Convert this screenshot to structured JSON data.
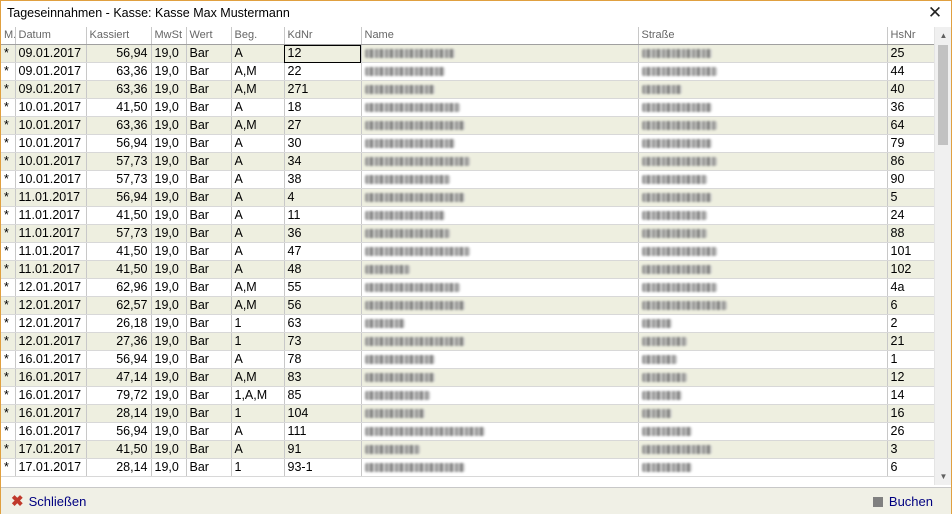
{
  "window": {
    "title": "Tageseinnahmen - Kasse: Kasse Max Mustermann",
    "close_glyph": "✕"
  },
  "columns": [
    "M.",
    "Datum",
    "Kassiert",
    "MwSt",
    "Wert",
    "Beg.",
    "KdNr",
    "Name",
    "Straße",
    "HsNr"
  ],
  "rows": [
    {
      "m": "*",
      "datum": "09.01.2017",
      "kassiert": "56,94",
      "mwst": "19,0",
      "wert": "Bar",
      "beg": "A",
      "kdnr": "12",
      "hsnr": "25"
    },
    {
      "m": "*",
      "datum": "09.01.2017",
      "kassiert": "63,36",
      "mwst": "19,0",
      "wert": "Bar",
      "beg": "A,M",
      "kdnr": "22",
      "hsnr": "44"
    },
    {
      "m": "*",
      "datum": "09.01.2017",
      "kassiert": "63,36",
      "mwst": "19,0",
      "wert": "Bar",
      "beg": "A,M",
      "kdnr": "271",
      "hsnr": "40"
    },
    {
      "m": "*",
      "datum": "10.01.2017",
      "kassiert": "41,50",
      "mwst": "19,0",
      "wert": "Bar",
      "beg": "A",
      "kdnr": "18",
      "hsnr": "36"
    },
    {
      "m": "*",
      "datum": "10.01.2017",
      "kassiert": "63,36",
      "mwst": "19,0",
      "wert": "Bar",
      "beg": "A,M",
      "kdnr": "27",
      "hsnr": "64"
    },
    {
      "m": "*",
      "datum": "10.01.2017",
      "kassiert": "56,94",
      "mwst": "19,0",
      "wert": "Bar",
      "beg": "A",
      "kdnr": "30",
      "hsnr": "79"
    },
    {
      "m": "*",
      "datum": "10.01.2017",
      "kassiert": "57,73",
      "mwst": "19,0",
      "wert": "Bar",
      "beg": "A",
      "kdnr": "34",
      "hsnr": "86"
    },
    {
      "m": "*",
      "datum": "10.01.2017",
      "kassiert": "57,73",
      "mwst": "19,0",
      "wert": "Bar",
      "beg": "A",
      "kdnr": "38",
      "hsnr": "90"
    },
    {
      "m": "*",
      "datum": "11.01.2017",
      "kassiert": "56,94",
      "mwst": "19,0",
      "wert": "Bar",
      "beg": "A",
      "kdnr": "4",
      "hsnr": "5"
    },
    {
      "m": "*",
      "datum": "11.01.2017",
      "kassiert": "41,50",
      "mwst": "19,0",
      "wert": "Bar",
      "beg": "A",
      "kdnr": "11",
      "hsnr": "24"
    },
    {
      "m": "*",
      "datum": "11.01.2017",
      "kassiert": "57,73",
      "mwst": "19,0",
      "wert": "Bar",
      "beg": "A",
      "kdnr": "36",
      "hsnr": "88"
    },
    {
      "m": "*",
      "datum": "11.01.2017",
      "kassiert": "41,50",
      "mwst": "19,0",
      "wert": "Bar",
      "beg": "A",
      "kdnr": "47",
      "hsnr": "101"
    },
    {
      "m": "*",
      "datum": "11.01.2017",
      "kassiert": "41,50",
      "mwst": "19,0",
      "wert": "Bar",
      "beg": "A",
      "kdnr": "48",
      "hsnr": "102"
    },
    {
      "m": "*",
      "datum": "12.01.2017",
      "kassiert": "62,96",
      "mwst": "19,0",
      "wert": "Bar",
      "beg": "A,M",
      "kdnr": "55",
      "hsnr": "4a"
    },
    {
      "m": "*",
      "datum": "12.01.2017",
      "kassiert": "62,57",
      "mwst": "19,0",
      "wert": "Bar",
      "beg": "A,M",
      "kdnr": "56",
      "hsnr": "6"
    },
    {
      "m": "*",
      "datum": "12.01.2017",
      "kassiert": "26,18",
      "mwst": "19,0",
      "wert": "Bar",
      "beg": "1",
      "kdnr": "63",
      "hsnr": "2"
    },
    {
      "m": "*",
      "datum": "12.01.2017",
      "kassiert": "27,36",
      "mwst": "19,0",
      "wert": "Bar",
      "beg": "1",
      "kdnr": "73",
      "hsnr": "21"
    },
    {
      "m": "*",
      "datum": "16.01.2017",
      "kassiert": "56,94",
      "mwst": "19,0",
      "wert": "Bar",
      "beg": "A",
      "kdnr": "78",
      "hsnr": "1"
    },
    {
      "m": "*",
      "datum": "16.01.2017",
      "kassiert": "47,14",
      "mwst": "19,0",
      "wert": "Bar",
      "beg": "A,M",
      "kdnr": "83",
      "hsnr": "12"
    },
    {
      "m": "*",
      "datum": "16.01.2017",
      "kassiert": "79,72",
      "mwst": "19,0",
      "wert": "Bar",
      "beg": "1,A,M",
      "kdnr": "85",
      "hsnr": "14"
    },
    {
      "m": "*",
      "datum": "16.01.2017",
      "kassiert": "28,14",
      "mwst": "19,0",
      "wert": "Bar",
      "beg": "1",
      "kdnr": "104",
      "hsnr": "16"
    },
    {
      "m": "*",
      "datum": "16.01.2017",
      "kassiert": "56,94",
      "mwst": "19,0",
      "wert": "Bar",
      "beg": "A",
      "kdnr": "111",
      "hsnr": "26"
    },
    {
      "m": "*",
      "datum": "17.01.2017",
      "kassiert": "41,50",
      "mwst": "19,0",
      "wert": "Bar",
      "beg": "A",
      "kdnr": "91",
      "hsnr": "3"
    },
    {
      "m": "*",
      "datum": "17.01.2017",
      "kassiert": "28,14",
      "mwst": "19,0",
      "wert": "Bar",
      "beg": "1",
      "kdnr": "93-1",
      "hsnr": "6"
    }
  ],
  "footer": {
    "close_label": "Schließen",
    "book_label": "Buchen"
  },
  "colors": {
    "row_alt": "#eeefe0",
    "border_accent": "#e0a040",
    "link": "#000080",
    "close_icon": "#c0392b"
  }
}
